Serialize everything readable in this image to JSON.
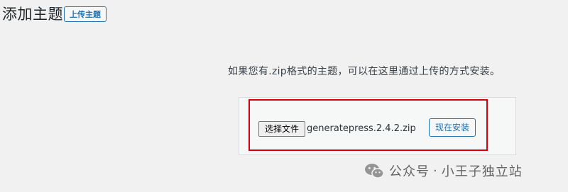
{
  "header": {
    "title": "添加主题",
    "upload_button": "上传主题"
  },
  "upload": {
    "help_text": "如果您有.zip格式的主题，可以在这里通过上传的方式安装。",
    "choose_file_button": "选择文件",
    "selected_file": "generatepress.2.4.2.zip",
    "install_button": "现在安装"
  },
  "watermark": {
    "prefix": "公众号",
    "separator": "·",
    "name": "小王子独立站"
  },
  "colors": {
    "accent": "#2271b1",
    "highlight": "#d40012",
    "background": "#f1f1f1"
  }
}
